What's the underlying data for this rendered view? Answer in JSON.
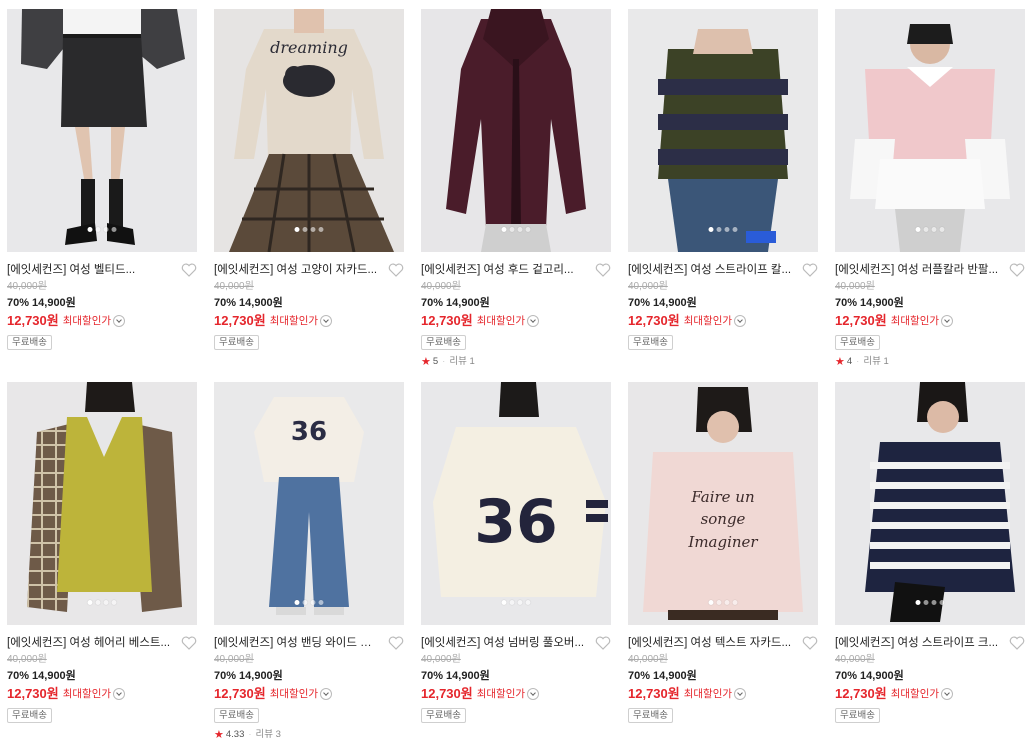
{
  "products": [
    {
      "title": "[에잇세컨즈] 여성 벨티드...",
      "original_price": "40,000원",
      "discount": "70%",
      "sale_price": "14,900원",
      "best_price": "12,730원",
      "best_label": "최대할인가",
      "badge": "무료배송",
      "rating": null,
      "review": null
    },
    {
      "title": "[에잇세컨즈] 여성 고양이 자카드...",
      "original_price": "40,000원",
      "discount": "70%",
      "sale_price": "14,900원",
      "best_price": "12,730원",
      "best_label": "최대할인가",
      "badge": "무료배송",
      "rating": null,
      "review": null
    },
    {
      "title": "[에잇세컨즈] 여성 후드 겉고리...",
      "original_price": "40,000원",
      "discount": "70%",
      "sale_price": "14,900원",
      "best_price": "12,730원",
      "best_label": "최대할인가",
      "badge": "무료배송",
      "rating": "5",
      "review": "리뷰 1"
    },
    {
      "title": "[에잇세컨즈] 여성 스트라이프 칼...",
      "original_price": "40,000원",
      "discount": "70%",
      "sale_price": "14,900원",
      "best_price": "12,730원",
      "best_label": "최대할인가",
      "badge": "무료배송",
      "rating": null,
      "review": null
    },
    {
      "title": "[에잇세컨즈] 여성 러플칼라 반팔...",
      "original_price": "40,000원",
      "discount": "70%",
      "sale_price": "14,900원",
      "best_price": "12,730원",
      "best_label": "최대할인가",
      "badge": "무료배송",
      "rating": "4",
      "review": "리뷰 1"
    },
    {
      "title": "[에잇세컨즈] 여성 헤어리 베스트...",
      "original_price": "40,000원",
      "discount": "70%",
      "sale_price": "14,900원",
      "best_price": "12,730원",
      "best_label": "최대할인가",
      "badge": "무료배송",
      "rating": null,
      "review": null
    },
    {
      "title": "[에잇세컨즈] 여성 밴딩 와이드 데...",
      "original_price": "40,000원",
      "discount": "70%",
      "sale_price": "14,900원",
      "best_price": "12,730원",
      "best_label": "최대할인가",
      "badge": "무료배송",
      "rating": "4.33",
      "review": "리뷰 3"
    },
    {
      "title": "[에잇세컨즈] 여성 넘버링 풀오버...",
      "original_price": "40,000원",
      "discount": "70%",
      "sale_price": "14,900원",
      "best_price": "12,730원",
      "best_label": "최대할인가",
      "badge": "무료배송",
      "rating": null,
      "review": null
    },
    {
      "title": "[에잇세컨즈] 여성 텍스트 자카드...",
      "original_price": "40,000원",
      "discount": "70%",
      "sale_price": "14,900원",
      "best_price": "12,730원",
      "best_label": "최대할인가",
      "badge": "무료배송",
      "rating": null,
      "review": null
    },
    {
      "title": "[에잇세컨즈] 여성 스트라이프 크...",
      "original_price": "40,000원",
      "discount": "70%",
      "sale_price": "14,900원",
      "best_price": "12,730원",
      "best_label": "최대할인가",
      "badge": "무료배송",
      "rating": null,
      "review": null
    }
  ],
  "image_text": {
    "dreaming": "dreaming",
    "number_36": "36",
    "script_line1": "Faire un",
    "script_line2": "songe",
    "script_line3": "Imaginer"
  },
  "colors": {
    "price_red": "#e5262c",
    "star_red": "#e5262c"
  },
  "icons": {
    "wishlist": "heart-outline-icon",
    "expand": "chevron-down-icon",
    "rating": "star-icon"
  }
}
